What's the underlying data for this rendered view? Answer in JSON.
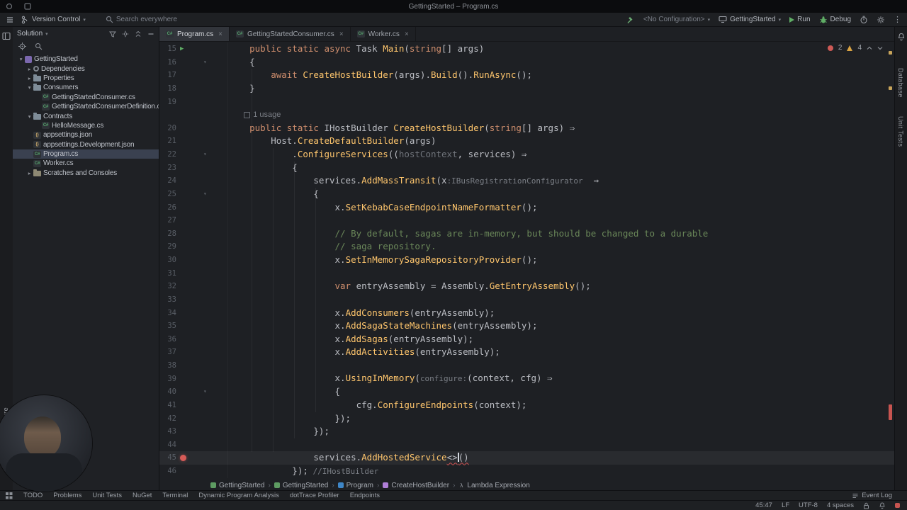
{
  "window": {
    "title": "GettingStarted – Program.cs"
  },
  "menubar": {
    "version_control": "Version Control",
    "search_placeholder": "Search everywhere",
    "configuration": "<No Configuration>",
    "run_target": "GettingStarted",
    "run": "Run",
    "debug": "Debug"
  },
  "solution_panel": {
    "header": "Solution",
    "tree": [
      {
        "label": "GettingStarted",
        "indent": 0,
        "icon": "sol",
        "state": "expanded"
      },
      {
        "label": "Dependencies",
        "indent": 1,
        "icon": "deps",
        "state": "collapsed"
      },
      {
        "label": "Properties",
        "indent": 1,
        "icon": "folder",
        "state": "collapsed"
      },
      {
        "label": "Consumers",
        "indent": 1,
        "icon": "folder",
        "state": "expanded"
      },
      {
        "label": "GettingStartedConsumer.cs",
        "indent": 2,
        "icon": "cs",
        "state": "none"
      },
      {
        "label": "GettingStartedConsumerDefinition.cs",
        "indent": 2,
        "icon": "cs",
        "state": "none"
      },
      {
        "label": "Contracts",
        "indent": 1,
        "icon": "folder",
        "state": "expanded"
      },
      {
        "label": "HelloMessage.cs",
        "indent": 2,
        "icon": "cs",
        "state": "none"
      },
      {
        "label": "appsettings.json",
        "indent": 1,
        "icon": "json",
        "state": "none"
      },
      {
        "label": "appsettings.Development.json",
        "indent": 1,
        "icon": "json",
        "state": "none"
      },
      {
        "label": "Program.cs",
        "indent": 1,
        "icon": "cs",
        "state": "none",
        "selected": true
      },
      {
        "label": "Worker.cs",
        "indent": 1,
        "icon": "cs",
        "state": "none"
      },
      {
        "label": "Scratches and Consoles",
        "indent": 1,
        "icon": "scratch",
        "state": "collapsed"
      }
    ]
  },
  "tabs": [
    {
      "label": "Program.cs",
      "active": true
    },
    {
      "label": "GettingStartedConsumer.cs",
      "active": false
    },
    {
      "label": "Worker.cs",
      "active": false
    }
  ],
  "editor": {
    "inspections": {
      "errors": "2",
      "warnings": "4"
    },
    "palette": {
      "d": "#BCBEC4",
      "k": "#CF8E6D",
      "m": "#FFC66D",
      "c": "#6A8759",
      "h": "#7A7E85",
      "u": "#6F737A",
      "sq": "#BCBEC4"
    },
    "rows": [
      {
        "n": 15,
        "ind": 4,
        "g": "run",
        "t": [
          [
            "k",
            "public static async "
          ],
          [
            "d",
            "Task "
          ],
          [
            "m",
            "Main"
          ],
          [
            "d",
            "("
          ],
          [
            "k",
            "string"
          ],
          [
            "d",
            "[] args)"
          ]
        ]
      },
      {
        "n": 16,
        "ind": 4,
        "fold": true,
        "t": [
          [
            "d",
            "{"
          ]
        ]
      },
      {
        "n": 17,
        "ind": 8,
        "t": [
          [
            "k",
            "await "
          ],
          [
            "m",
            "CreateHostBuilder"
          ],
          [
            "d",
            "(args)."
          ],
          [
            "m",
            "Build"
          ],
          [
            "d",
            "()."
          ],
          [
            "m",
            "RunAsync"
          ],
          [
            "d",
            "();"
          ]
        ]
      },
      {
        "n": 18,
        "ind": 4,
        "t": [
          [
            "d",
            "}"
          ]
        ]
      },
      {
        "n": 19,
        "ind": 0,
        "t": []
      },
      {
        "usage": true,
        "ind": 4,
        "t": [
          [
            "h",
            "1 usage"
          ]
        ]
      },
      {
        "n": 20,
        "ind": 4,
        "t": [
          [
            "k",
            "public static "
          ],
          [
            "d",
            "IHostBuilder "
          ],
          [
            "m",
            "CreateHostBuilder"
          ],
          [
            "d",
            "("
          ],
          [
            "k",
            "string"
          ],
          [
            "d",
            "[] args) ⇒"
          ]
        ]
      },
      {
        "n": 21,
        "ind": 8,
        "t": [
          [
            "d",
            "Host."
          ],
          [
            "m",
            "CreateDefaultBuilder"
          ],
          [
            "d",
            "(args)"
          ]
        ]
      },
      {
        "n": 22,
        "ind": 12,
        "fold": true,
        "t": [
          [
            "d",
            "."
          ],
          [
            "m",
            "ConfigureServices"
          ],
          [
            "d",
            "(("
          ],
          [
            "u",
            "hostContext"
          ],
          [
            "d",
            ", services) ⇒"
          ]
        ]
      },
      {
        "n": 23,
        "ind": 12,
        "t": [
          [
            "d",
            "{"
          ]
        ]
      },
      {
        "n": 24,
        "ind": 16,
        "t": [
          [
            "d",
            "services."
          ],
          [
            "m",
            "AddMassTransit"
          ],
          [
            "d",
            "(x"
          ],
          [
            "h",
            ":IBusRegistrationConfigurator"
          ],
          [
            "d",
            "  ⇒"
          ]
        ]
      },
      {
        "n": 25,
        "ind": 16,
        "fold": true,
        "t": [
          [
            "d",
            "{"
          ]
        ]
      },
      {
        "n": 26,
        "ind": 20,
        "t": [
          [
            "d",
            "x."
          ],
          [
            "m",
            "SetKebabCaseEndpointNameFormatter"
          ],
          [
            "d",
            "();"
          ]
        ]
      },
      {
        "n": 27,
        "ind": 0,
        "t": []
      },
      {
        "n": 28,
        "ind": 20,
        "t": [
          [
            "c",
            "// By default, sagas are in-memory, but should be changed to a durable"
          ]
        ]
      },
      {
        "n": 29,
        "ind": 20,
        "t": [
          [
            "c",
            "// saga repository."
          ]
        ]
      },
      {
        "n": 30,
        "ind": 20,
        "t": [
          [
            "d",
            "x."
          ],
          [
            "m",
            "SetInMemorySagaRepositoryProvider"
          ],
          [
            "d",
            "();"
          ]
        ]
      },
      {
        "n": 31,
        "ind": 0,
        "t": []
      },
      {
        "n": 32,
        "ind": 20,
        "t": [
          [
            "k",
            "var"
          ],
          [
            "d",
            " entryAssembly = Assembly."
          ],
          [
            "m",
            "GetEntryAssembly"
          ],
          [
            "d",
            "();"
          ]
        ]
      },
      {
        "n": 33,
        "ind": 0,
        "t": []
      },
      {
        "n": 34,
        "ind": 20,
        "t": [
          [
            "d",
            "x."
          ],
          [
            "m",
            "AddConsumers"
          ],
          [
            "d",
            "(entryAssembly);"
          ]
        ]
      },
      {
        "n": 35,
        "ind": 20,
        "t": [
          [
            "d",
            "x."
          ],
          [
            "m",
            "AddSagaStateMachines"
          ],
          [
            "d",
            "(entryAssembly);"
          ]
        ]
      },
      {
        "n": 36,
        "ind": 20,
        "t": [
          [
            "d",
            "x."
          ],
          [
            "m",
            "AddSagas"
          ],
          [
            "d",
            "(entryAssembly);"
          ]
        ]
      },
      {
        "n": 37,
        "ind": 20,
        "t": [
          [
            "d",
            "x."
          ],
          [
            "m",
            "AddActivities"
          ],
          [
            "d",
            "(entryAssembly);"
          ]
        ]
      },
      {
        "n": 38,
        "ind": 0,
        "t": []
      },
      {
        "n": 39,
        "ind": 20,
        "t": [
          [
            "d",
            "x."
          ],
          [
            "m",
            "UsingInMemory"
          ],
          [
            "d",
            "("
          ],
          [
            "h",
            "configure:"
          ],
          [
            "d",
            "(context, cfg) ⇒"
          ]
        ]
      },
      {
        "n": 40,
        "ind": 20,
        "fold": true,
        "t": [
          [
            "d",
            "{"
          ]
        ]
      },
      {
        "n": 41,
        "ind": 24,
        "t": [
          [
            "d",
            "cfg."
          ],
          [
            "m",
            "ConfigureEndpoints"
          ],
          [
            "d",
            "(context);"
          ]
        ]
      },
      {
        "n": 42,
        "ind": 20,
        "t": [
          [
            "d",
            "});"
          ]
        ]
      },
      {
        "n": 43,
        "ind": 16,
        "t": [
          [
            "d",
            "});"
          ]
        ]
      },
      {
        "n": 44,
        "ind": 0,
        "t": []
      },
      {
        "n": 45,
        "ind": 16,
        "g": "bp",
        "cur": true,
        "t": [
          [
            "d",
            "services."
          ],
          [
            "m",
            "AddHostedService"
          ],
          [
            "sq",
            "<>"
          ],
          [
            "caret",
            ""
          ],
          [
            "sq",
            "()"
          ]
        ]
      },
      {
        "n": 46,
        "ind": 12,
        "t": [
          [
            "d",
            "});"
          ],
          [
            "h",
            " //IHostBuilder"
          ]
        ]
      }
    ]
  },
  "breadcrumbs": {
    "items": [
      {
        "label": "GettingStarted",
        "icon": "project",
        "color": "#5E9C62"
      },
      {
        "label": "GettingStarted",
        "icon": "project",
        "color": "#5E9C62"
      },
      {
        "label": "Program",
        "icon": "class",
        "color": "#3E86C7"
      },
      {
        "label": "CreateHostBuilder",
        "icon": "method",
        "color": "#B07FD8"
      },
      {
        "label": "Lambda Expression",
        "icon": "lambda",
        "color": "#9CA0A7"
      }
    ]
  },
  "bottom_toolbar": {
    "items": [
      "TODO",
      "Problems",
      "Unit Tests",
      "NuGet",
      "Terminal",
      "Dynamic Program Analysis",
      "dotTrace Profiler",
      "Endpoints"
    ],
    "event_log": "Event Log"
  },
  "status_bar": {
    "caret": "45:47",
    "line_ending": "LF",
    "encoding": "UTF-8",
    "indent": "4 spaces"
  },
  "tool_stripes": {
    "left": [
      "Structure"
    ],
    "right": [
      "Database",
      "Unit Tests"
    ]
  }
}
